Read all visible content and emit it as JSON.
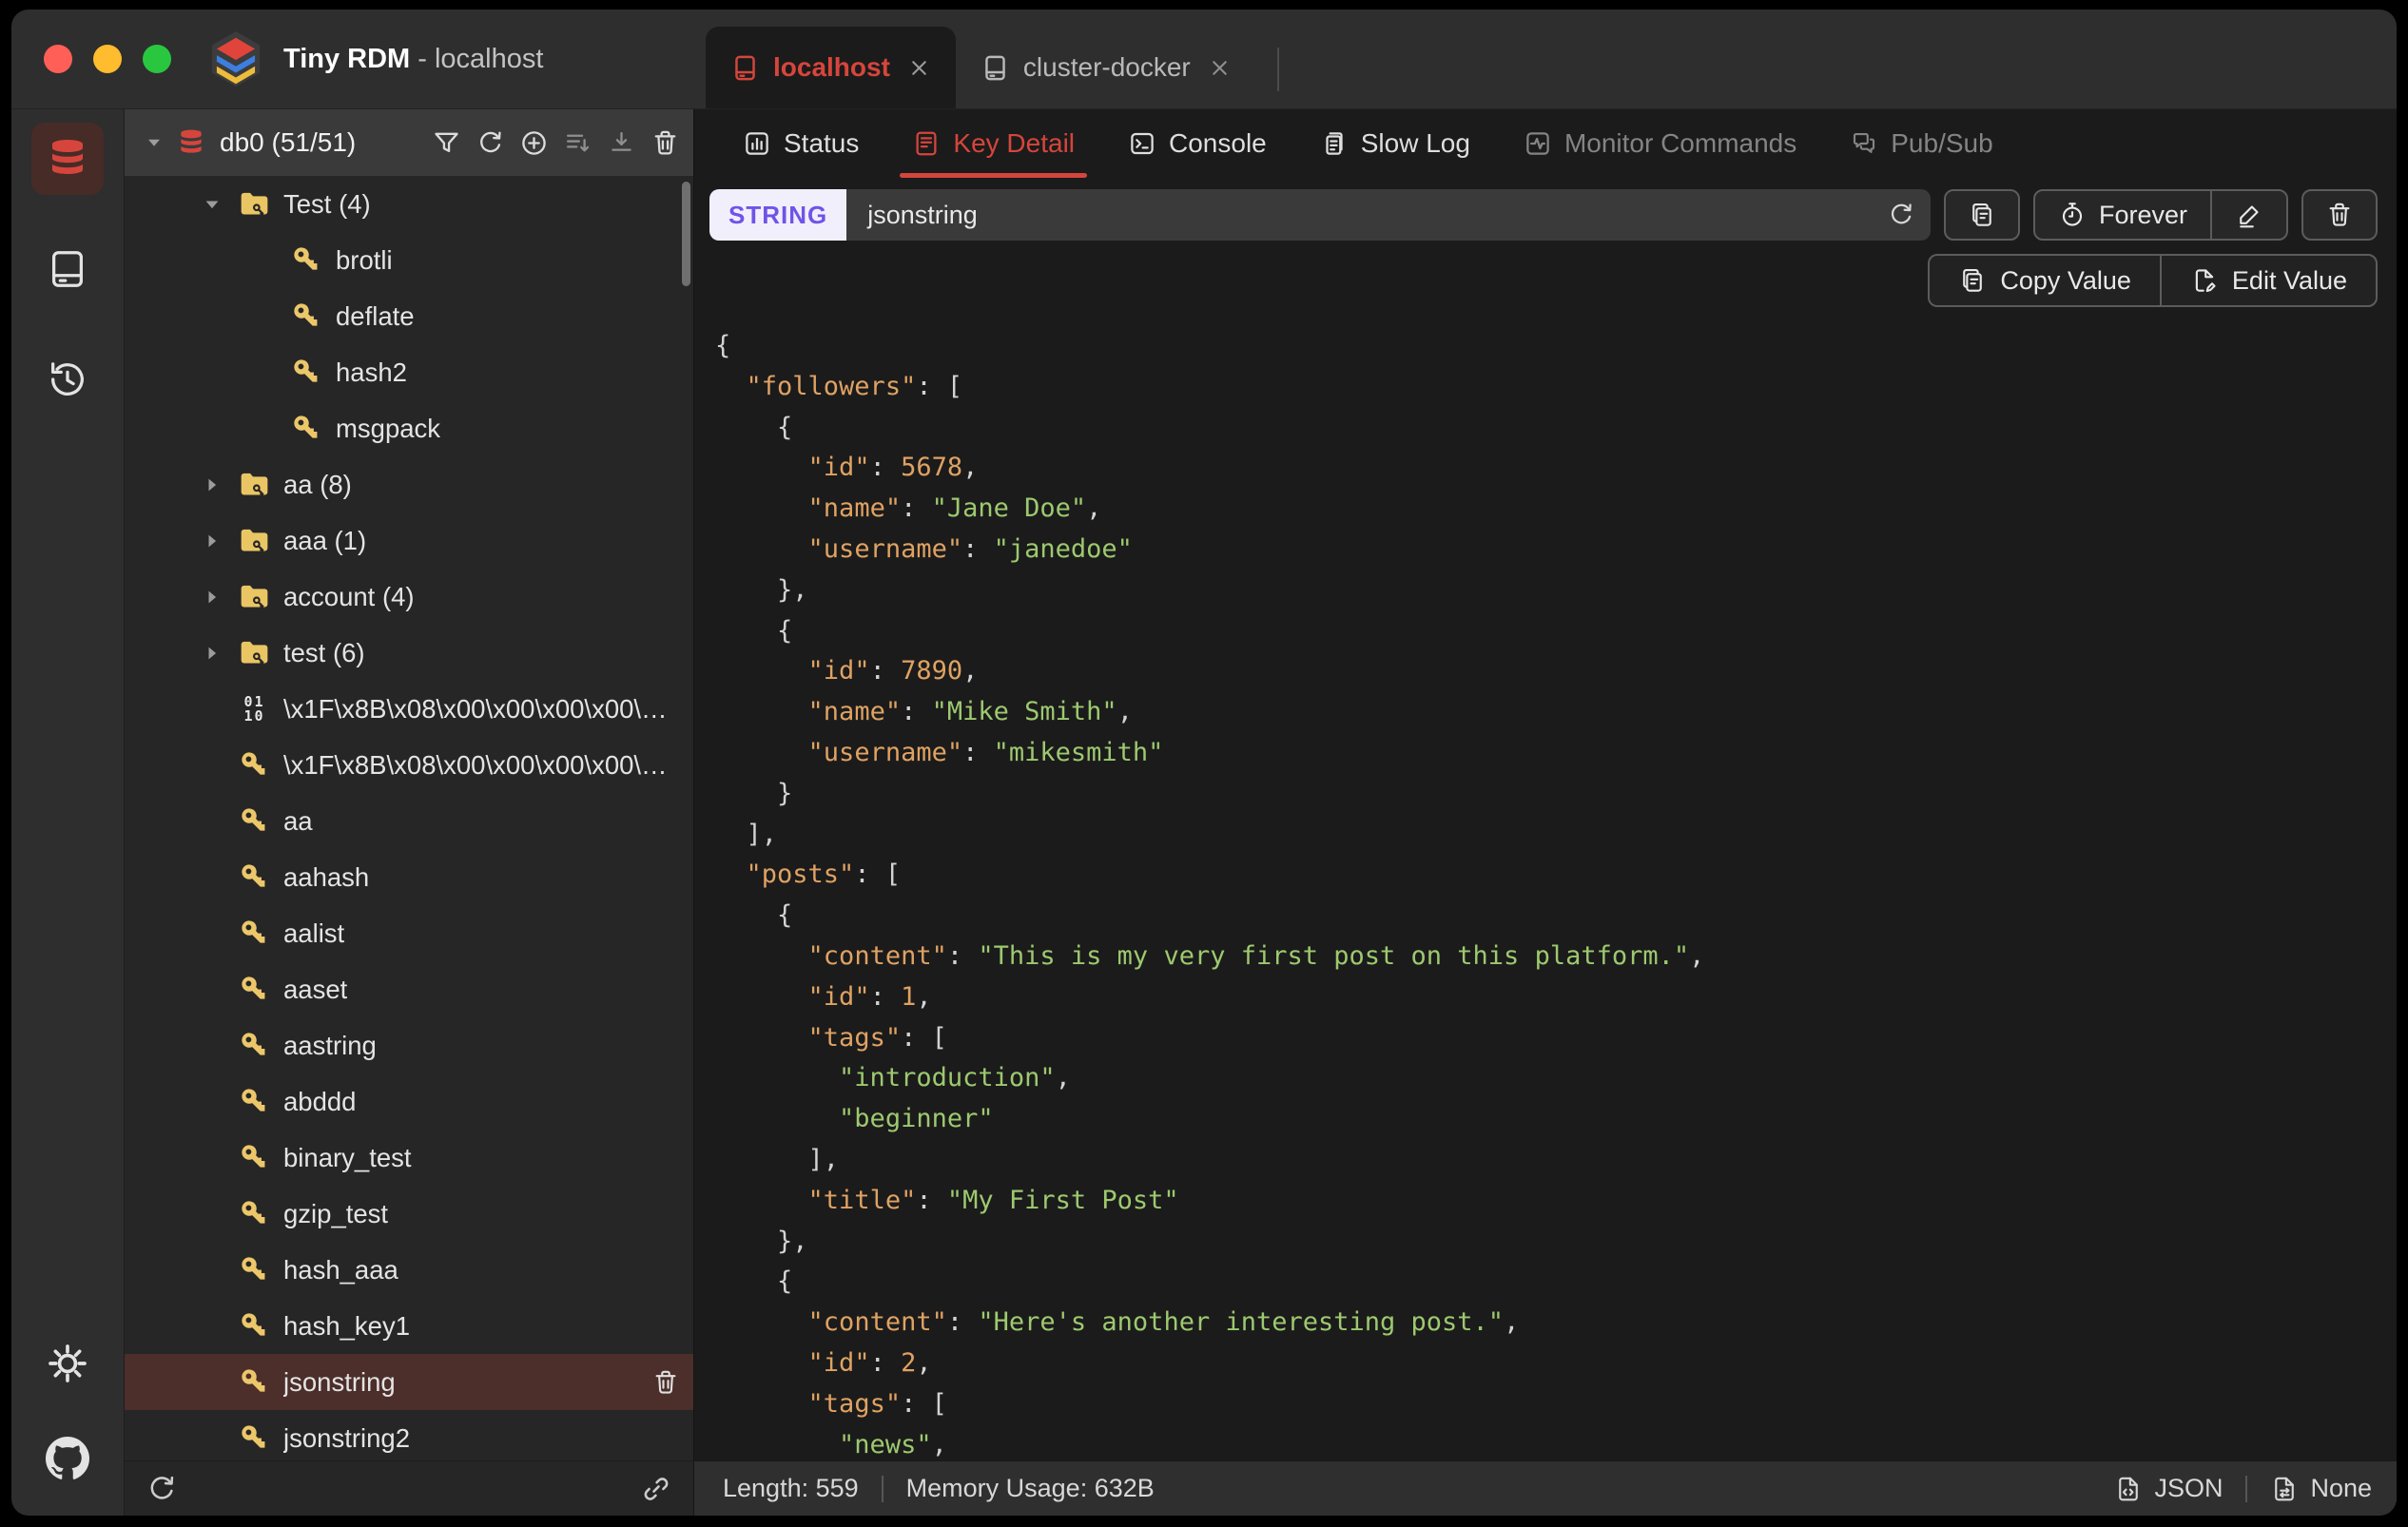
{
  "window": {
    "app_title": "Tiny RDM",
    "title_suffix": " - localhost"
  },
  "colors": {
    "accent_red": "#d6453c",
    "badge_purple": "#6f54e8",
    "badge_bg": "#f2effd",
    "key_yellow": "#ecc76a",
    "folder_yellow": "#eac564",
    "selected_row_bg": "#4c2e2a",
    "json_key": "#dfa263",
    "json_string": "#9dc96f",
    "json_number": "#dfa263"
  },
  "connection_tabs": [
    {
      "label": "localhost",
      "active": true
    },
    {
      "label": "cluster-docker",
      "active": false
    }
  ],
  "main_tabs": [
    {
      "label": "Status"
    },
    {
      "label": "Key Detail",
      "active": true
    },
    {
      "label": "Console"
    },
    {
      "label": "Slow Log"
    },
    {
      "label": "Monitor Commands",
      "disabled": true
    },
    {
      "label": "Pub/Sub",
      "disabled": true
    }
  ],
  "key_detail": {
    "type_badge": "STRING",
    "key_name": "jsonstring",
    "ttl_label": "Forever",
    "copy_value_label": "Copy Value",
    "edit_value_label": "Edit Value"
  },
  "sidebar": {
    "db_header": {
      "label": "db0 (51/51)"
    },
    "items": [
      {
        "kind": "folder",
        "label": "Test (4)",
        "expanded": true,
        "level": 1
      },
      {
        "kind": "key",
        "label": "brotli",
        "level": 2
      },
      {
        "kind": "key",
        "label": "deflate",
        "level": 2
      },
      {
        "kind": "key",
        "label": "hash2",
        "level": 2
      },
      {
        "kind": "key",
        "label": "msgpack",
        "level": 2
      },
      {
        "kind": "folder",
        "label": "aa (8)",
        "expanded": false,
        "level": 1
      },
      {
        "kind": "folder",
        "label": "aaa (1)",
        "expanded": false,
        "level": 1
      },
      {
        "kind": "folder",
        "label": "account (4)",
        "expanded": false,
        "level": 1
      },
      {
        "kind": "folder",
        "label": "test (6)",
        "expanded": false,
        "level": 1
      },
      {
        "kind": "binary",
        "label": "\\x1F\\x8B\\x08\\x00\\x00\\x00\\x00\\x00...",
        "level": 1
      },
      {
        "kind": "key",
        "label": "\\x1F\\x8B\\x08\\x00\\x00\\x00\\x00\\x00...",
        "level": 1
      },
      {
        "kind": "key",
        "label": "aa",
        "level": 1
      },
      {
        "kind": "key",
        "label": "aahash",
        "level": 1
      },
      {
        "kind": "key",
        "label": "aalist",
        "level": 1
      },
      {
        "kind": "key",
        "label": "aaset",
        "level": 1
      },
      {
        "kind": "key",
        "label": "aastring",
        "level": 1
      },
      {
        "kind": "key",
        "label": "abddd",
        "level": 1
      },
      {
        "kind": "key",
        "label": "binary_test",
        "level": 1
      },
      {
        "kind": "key",
        "label": "gzip_test",
        "level": 1
      },
      {
        "kind": "key",
        "label": "hash_aaa",
        "level": 1
      },
      {
        "kind": "key",
        "label": "hash_key1",
        "level": 1
      },
      {
        "kind": "key",
        "label": "jsonstring",
        "level": 1,
        "selected": true
      },
      {
        "kind": "key",
        "label": "jsonstring2",
        "level": 1
      }
    ]
  },
  "status_bar": {
    "length": "Length: 559",
    "memory": "Memory Usage: 632B",
    "format": "JSON",
    "decode": "None"
  },
  "json_doc": {
    "lines": [
      [
        [
          "p",
          "{"
        ]
      ],
      [
        [
          "p",
          "  "
        ],
        [
          "k",
          "\"followers\""
        ],
        [
          "p",
          ": ["
        ]
      ],
      [
        [
          "p",
          "    {"
        ]
      ],
      [
        [
          "p",
          "      "
        ],
        [
          "k",
          "\"id\""
        ],
        [
          "p",
          ": "
        ],
        [
          "n",
          "5678"
        ],
        [
          "p",
          ","
        ]
      ],
      [
        [
          "p",
          "      "
        ],
        [
          "k",
          "\"name\""
        ],
        [
          "p",
          ": "
        ],
        [
          "s",
          "\"Jane Doe\""
        ],
        [
          "p",
          ","
        ]
      ],
      [
        [
          "p",
          "      "
        ],
        [
          "k",
          "\"username\""
        ],
        [
          "p",
          ": "
        ],
        [
          "s",
          "\"janedoe\""
        ]
      ],
      [
        [
          "p",
          "    },"
        ]
      ],
      [
        [
          "p",
          "    {"
        ]
      ],
      [
        [
          "p",
          "      "
        ],
        [
          "k",
          "\"id\""
        ],
        [
          "p",
          ": "
        ],
        [
          "n",
          "7890"
        ],
        [
          "p",
          ","
        ]
      ],
      [
        [
          "p",
          "      "
        ],
        [
          "k",
          "\"name\""
        ],
        [
          "p",
          ": "
        ],
        [
          "s",
          "\"Mike Smith\""
        ],
        [
          "p",
          ","
        ]
      ],
      [
        [
          "p",
          "      "
        ],
        [
          "k",
          "\"username\""
        ],
        [
          "p",
          ": "
        ],
        [
          "s",
          "\"mikesmith\""
        ]
      ],
      [
        [
          "p",
          "    }"
        ]
      ],
      [
        [
          "p",
          "  ],"
        ]
      ],
      [
        [
          "p",
          "  "
        ],
        [
          "k",
          "\"posts\""
        ],
        [
          "p",
          ": ["
        ]
      ],
      [
        [
          "p",
          "    {"
        ]
      ],
      [
        [
          "p",
          "      "
        ],
        [
          "k",
          "\"content\""
        ],
        [
          "p",
          ": "
        ],
        [
          "s",
          "\"This is my very first post on this platform.\""
        ],
        [
          "p",
          ","
        ]
      ],
      [
        [
          "p",
          "      "
        ],
        [
          "k",
          "\"id\""
        ],
        [
          "p",
          ": "
        ],
        [
          "n",
          "1"
        ],
        [
          "p",
          ","
        ]
      ],
      [
        [
          "p",
          "      "
        ],
        [
          "k",
          "\"tags\""
        ],
        [
          "p",
          ": ["
        ]
      ],
      [
        [
          "p",
          "        "
        ],
        [
          "s",
          "\"introduction\""
        ],
        [
          "p",
          ","
        ]
      ],
      [
        [
          "p",
          "        "
        ],
        [
          "s",
          "\"beginner\""
        ]
      ],
      [
        [
          "p",
          "      ],"
        ]
      ],
      [
        [
          "p",
          "      "
        ],
        [
          "k",
          "\"title\""
        ],
        [
          "p",
          ": "
        ],
        [
          "s",
          "\"My First Post\""
        ]
      ],
      [
        [
          "p",
          "    },"
        ]
      ],
      [
        [
          "p",
          "    {"
        ]
      ],
      [
        [
          "p",
          "      "
        ],
        [
          "k",
          "\"content\""
        ],
        [
          "p",
          ": "
        ],
        [
          "s",
          "\"Here's another interesting post.\""
        ],
        [
          "p",
          ","
        ]
      ],
      [
        [
          "p",
          "      "
        ],
        [
          "k",
          "\"id\""
        ],
        [
          "p",
          ": "
        ],
        [
          "n",
          "2"
        ],
        [
          "p",
          ","
        ]
      ],
      [
        [
          "p",
          "      "
        ],
        [
          "k",
          "\"tags\""
        ],
        [
          "p",
          ": ["
        ]
      ],
      [
        [
          "p",
          "        "
        ],
        [
          "s",
          "\"news\""
        ],
        [
          "p",
          ","
        ]
      ]
    ]
  }
}
